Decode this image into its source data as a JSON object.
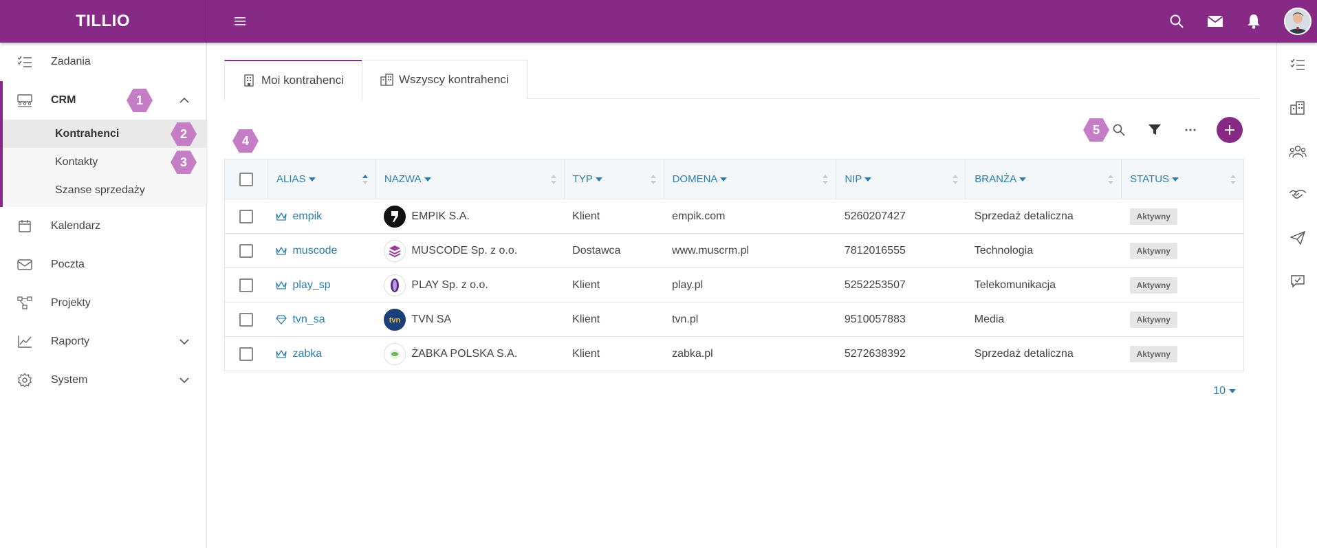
{
  "app": {
    "brand": "TILLIO"
  },
  "sidebar": {
    "items": [
      {
        "label": "Zadania"
      },
      {
        "label": "CRM",
        "badge": "1",
        "children": [
          {
            "label": "Kontrahenci",
            "badge": "2"
          },
          {
            "label": "Kontakty",
            "badge": "3"
          },
          {
            "label": "Szanse sprzedaży"
          }
        ]
      },
      {
        "label": "Kalendarz"
      },
      {
        "label": "Poczta"
      },
      {
        "label": "Projekty"
      },
      {
        "label": "Raporty"
      },
      {
        "label": "System"
      }
    ]
  },
  "tabs": [
    {
      "label": "Moi kontrahenci",
      "active": true
    },
    {
      "label": "Wszyscy kontrahenci",
      "active": false
    }
  ],
  "annotations": {
    "table_badge": "4",
    "toolbar_badge": "5"
  },
  "table": {
    "columns": [
      "ALIAS",
      "NAZWA",
      "TYP",
      "DOMENA",
      "NIP",
      "BRANŻA",
      "STATUS"
    ],
    "rows": [
      {
        "alias": "empik",
        "alias_icon": "crown-icon",
        "name": "EMPIK S.A.",
        "type": "Klient",
        "domain": "empik.com",
        "nip": "5260207427",
        "industry": "Sprzedaż detaliczna",
        "status": "Aktywny"
      },
      {
        "alias": "muscode",
        "alias_icon": "crown-icon",
        "name": "MUSCODE Sp. z o.o.",
        "type": "Dostawca",
        "domain": "www.muscrm.pl",
        "nip": "7812016555",
        "industry": "Technologia",
        "status": "Aktywny"
      },
      {
        "alias": "play_sp",
        "alias_icon": "crown-icon",
        "name": "PLAY Sp. z o.o.",
        "type": "Klient",
        "domain": "play.pl",
        "nip": "5252253507",
        "industry": "Telekomunikacja",
        "status": "Aktywny"
      },
      {
        "alias": "tvn_sa",
        "alias_icon": "diamond-icon",
        "name": "TVN SA",
        "type": "Klient",
        "domain": "tvn.pl",
        "nip": "9510057883",
        "industry": "Media",
        "status": "Aktywny"
      },
      {
        "alias": "zabka",
        "alias_icon": "crown-icon",
        "name": "ŻABKA POLSKA S.A.",
        "type": "Klient",
        "domain": "zabka.pl",
        "nip": "5272638392",
        "industry": "Sprzedaż detaliczna",
        "status": "Aktywny"
      }
    ]
  },
  "pagination": {
    "page_size": "10"
  },
  "colors": {
    "brand": "#862a86",
    "link": "#2a7fa8",
    "badge": "#c57ec5"
  }
}
